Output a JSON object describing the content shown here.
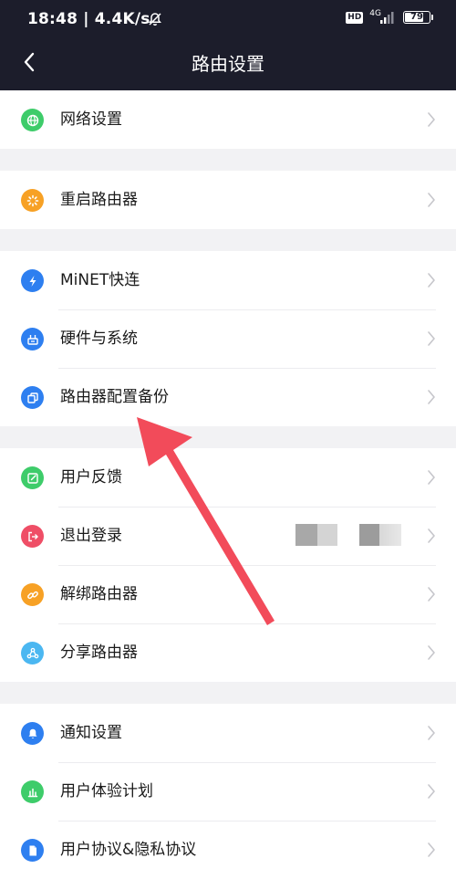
{
  "status_bar": {
    "time": "18:48 | 4.4K/s",
    "hd": "HD",
    "network": "4G",
    "battery": "79",
    "battery_level_percent": 79
  },
  "header": {
    "title": "路由设置"
  },
  "colors": {
    "header_bg": "#1c1d2b",
    "green": "#3ecc6a",
    "orange": "#f7a125",
    "blue": "#2e7ff0",
    "red": "#ef4e66",
    "light_blue": "#4bb7f1",
    "arrow": "#f24b5a"
  },
  "groups": [
    {
      "items": [
        {
          "id": "network",
          "label": "网络设置",
          "icon": "globe-icon"
        }
      ]
    },
    {
      "items": [
        {
          "id": "restart",
          "label": "重启路由器",
          "icon": "loading-icon"
        }
      ]
    },
    {
      "items": [
        {
          "id": "minet",
          "label": "MiNET快连",
          "icon": "lightning-icon"
        },
        {
          "id": "hardware",
          "label": "硬件与系统",
          "icon": "router-icon"
        },
        {
          "id": "backup",
          "label": "路由器配置备份",
          "icon": "copy-icon"
        }
      ]
    },
    {
      "items": [
        {
          "id": "feedback",
          "label": "用户反馈",
          "icon": "edit-icon"
        },
        {
          "id": "logout",
          "label": "退出登录",
          "icon": "logout-icon"
        },
        {
          "id": "unbind",
          "label": "解绑路由器",
          "icon": "link-icon"
        },
        {
          "id": "share",
          "label": "分享路由器",
          "icon": "share-icon"
        }
      ]
    },
    {
      "items": [
        {
          "id": "notify",
          "label": "通知设置",
          "icon": "bell-icon"
        },
        {
          "id": "ux",
          "label": "用户体验计划",
          "icon": "chart-icon"
        },
        {
          "id": "policy",
          "label": "用户协议&隐私协议",
          "icon": "document-icon"
        }
      ]
    }
  ]
}
